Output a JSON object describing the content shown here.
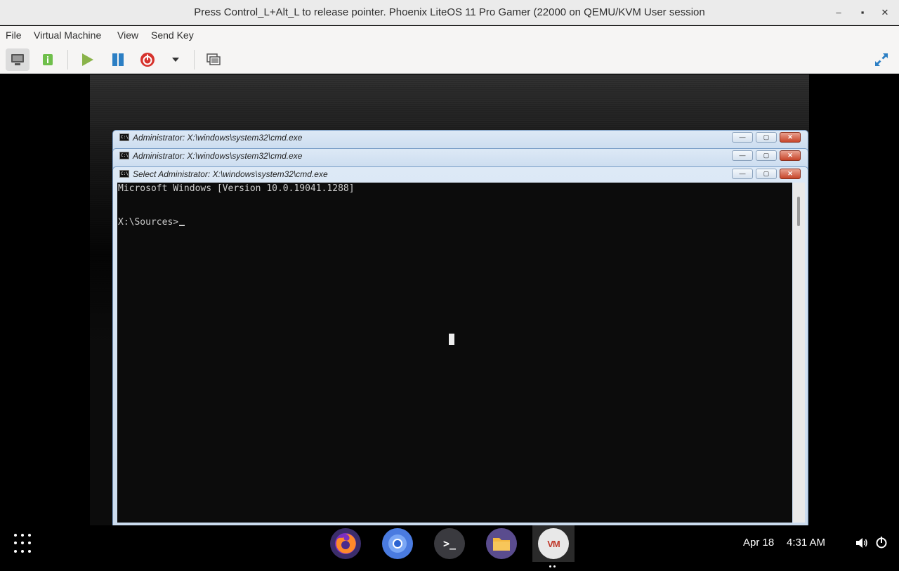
{
  "window": {
    "title": "Press Control_L+Alt_L to release pointer. Phoenix LiteOS 11 Pro Gamer (22000 on QEMU/KVM User session",
    "minimize_glyph": "–",
    "maximize_glyph": "▪",
    "close_glyph": "✕"
  },
  "menu": {
    "items": [
      "File",
      "Virtual Machine",
      "View",
      "Send Key"
    ]
  },
  "toolbar": {
    "buttons": [
      {
        "name": "console-view",
        "icon": "monitor-icon",
        "active": true
      },
      {
        "name": "details-view",
        "icon": "info-icon",
        "active": false
      },
      {
        "name": "run",
        "icon": "play-icon",
        "color": "#8ab34a"
      },
      {
        "name": "pause",
        "icon": "pause-icon",
        "color": "#2c7fc4"
      },
      {
        "name": "shutdown",
        "icon": "power-icon",
        "color": "#d6322c"
      },
      {
        "name": "shutdown-menu",
        "icon": "dropdown-arrow-icon"
      },
      {
        "name": "snapshots",
        "icon": "snapshot-icon"
      },
      {
        "name": "fullscreen",
        "icon": "fullscreen-icon",
        "color": "#2c7fc4"
      }
    ]
  },
  "guest": {
    "cmd_windows": [
      {
        "title": "Administrator: X:\\windows\\system32\\cmd.exe"
      },
      {
        "title": "Administrator: X:\\windows\\system32\\cmd.exe"
      },
      {
        "title": "Select Administrator: X:\\windows\\system32\\cmd.exe"
      }
    ],
    "cmd_icon_text": "C:\\",
    "console_lines": [
      "Microsoft Windows [Version 10.0.19041.1288]",
      "",
      "",
      "X:\\Sources>"
    ],
    "button_glyphs": {
      "minimize": "—",
      "maximize": "▢",
      "close": "✕"
    }
  },
  "taskbar": {
    "dock": [
      {
        "name": "firefox",
        "icon": "firefox-icon"
      },
      {
        "name": "chromium",
        "icon": "chromium-icon"
      },
      {
        "name": "terminal",
        "icon": "terminal-icon",
        "glyph": ">_"
      },
      {
        "name": "files",
        "icon": "folder-icon"
      },
      {
        "name": "virt-manager",
        "icon": "vm-icon",
        "glyph": "VM",
        "active": true
      }
    ],
    "date": "Apr 18",
    "time": "4:31 AM"
  },
  "colors": {
    "cmd_bg": "#0c0c0c",
    "cmd_text": "#cccccc",
    "title_gradient_top": "#dde9f6",
    "close_red": "#c7452a"
  }
}
